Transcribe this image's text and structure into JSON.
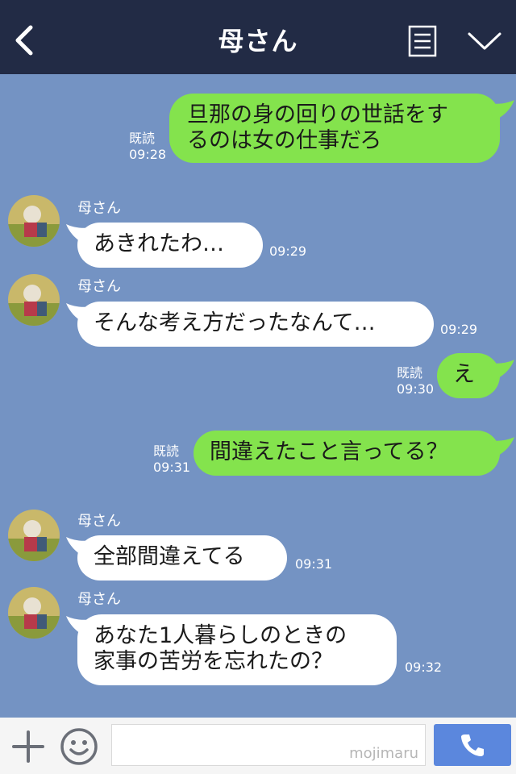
{
  "header": {
    "title": "母さん",
    "back_icon": "chevron-left-icon",
    "menu_icon": "list-icon",
    "collapse_icon": "chevron-down-icon"
  },
  "messages": [
    {
      "from": "me",
      "lines": [
        "旦那の身の回りの世話をす",
        "るのは女の仕事だろ"
      ],
      "read": "既読",
      "time": "09:28"
    },
    {
      "from": "them",
      "sender": "母さん",
      "lines": [
        "あきれたわ…"
      ],
      "time": "09:29"
    },
    {
      "from": "them",
      "sender": "母さん",
      "lines": [
        "そんな考え方だったなんて…"
      ],
      "time": "09:29"
    },
    {
      "from": "me",
      "lines": [
        "え"
      ],
      "read": "既読",
      "time": "09:30"
    },
    {
      "from": "me",
      "lines": [
        "間違えたこと言ってる？"
      ],
      "read": "既読",
      "time": "09:31"
    },
    {
      "from": "them",
      "sender": "母さん",
      "lines": [
        "全部間違えてる"
      ],
      "time": "09:31"
    },
    {
      "from": "them",
      "sender": "母さん",
      "lines": [
        "あなた1人暮らしのときの",
        "家事の苦労を忘れたの？"
      ],
      "time": "09:32"
    }
  ],
  "footer": {
    "watermark": "mojimaru",
    "plus_icon": "plus-icon",
    "emoji_icon": "smiley-icon",
    "call_icon": "phone-icon"
  },
  "colors": {
    "background": "#7493c3",
    "header": "#222b45",
    "my_bubble": "#84e34d",
    "their_bubble": "#ffffff",
    "call_button": "#5b87dd"
  }
}
